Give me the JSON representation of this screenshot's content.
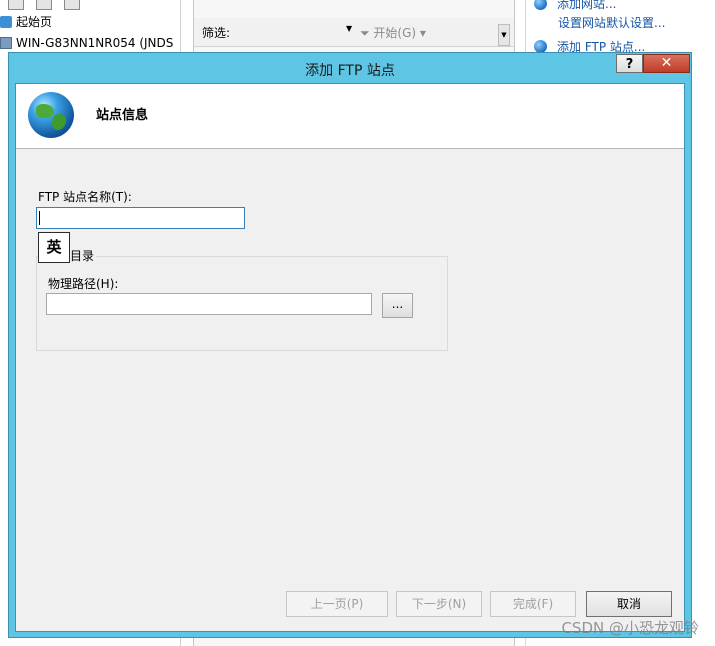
{
  "background": {
    "tree": [
      {
        "label": "起始页"
      },
      {
        "label": "WIN-G83NN1NR054 (JNDS"
      }
    ],
    "filter": {
      "label": "筛选:",
      "start": "开始(G)"
    },
    "actions": [
      {
        "label": "添加网站..."
      },
      {
        "label": "设置网站默认设置..."
      },
      {
        "label": "添加 FTP 站点..."
      }
    ]
  },
  "dialog": {
    "title": "添加 FTP 站点",
    "help": "?",
    "close": "✕",
    "header": "站点信息",
    "site_name_label": "FTP 站点名称(T):",
    "site_name_value": "",
    "ime_indicator": "英",
    "content_dir_label": "目录",
    "physical_path_label": "物理路径(H):",
    "physical_path_value": "",
    "browse": "...",
    "buttons": {
      "prev": "上一页(P)",
      "next": "下一步(N)",
      "finish": "完成(F)",
      "cancel": "取消"
    }
  },
  "watermark": "CSDN @小恐龙观铃"
}
